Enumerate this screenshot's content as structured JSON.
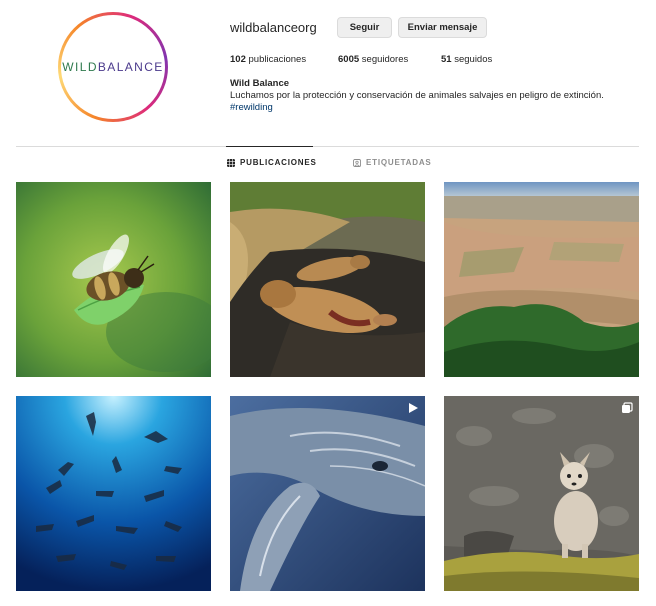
{
  "profile": {
    "username": "wildbalanceorg",
    "avatar_logo_part1": "WILD",
    "avatar_logo_part2": "BALANCE",
    "follow_label": "Seguir",
    "message_label": "Enviar mensaje",
    "stats": {
      "posts_count": "102",
      "posts_label": "publicaciones",
      "followers_count": "6005",
      "followers_label": "seguidores",
      "following_count": "51",
      "following_label": "seguidos"
    },
    "bio": {
      "name": "Wild Balance",
      "text": "Luchamos por la protección y conservación de animales salvajes en peligro de extinción.",
      "hashtag": "#rewilding"
    }
  },
  "tabs": {
    "posts": "PUBLICACIONES",
    "tagged": "ETIQUETADAS",
    "active": "posts"
  },
  "colors": {
    "link": "#00376b",
    "muted": "#8e8e8e",
    "text": "#262626",
    "border": "#dbdbdb"
  },
  "posts": [
    {
      "subject": "bee carrying leaf",
      "badge": null
    },
    {
      "subject": "dead lions on ground",
      "badge": null
    },
    {
      "subject": "aerial view of deforestation",
      "badge": null
    },
    {
      "subject": "sharks underwater",
      "badge": null
    },
    {
      "subject": "whale close-up",
      "badge": "video-icon"
    },
    {
      "subject": "arctic fox on rocks",
      "badge": "carousel-icon"
    }
  ]
}
